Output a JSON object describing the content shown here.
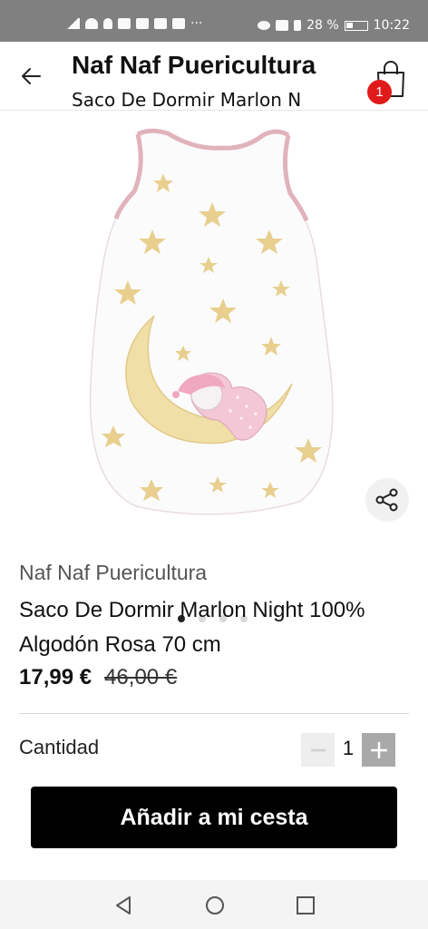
{
  "status_bar": {
    "battery": "28 %",
    "time": "10:22",
    "left_icons": [
      "signal-icon",
      "wifi-icon",
      "notification-icon",
      "whatsapp-icon",
      "gallery-icon",
      "gallery-icon",
      "mail-icon",
      "more-icon"
    ],
    "right_icons": [
      "eye-icon",
      "nfc-icon",
      "bluetooth-icon",
      "battery-icon"
    ]
  },
  "header": {
    "title": "Naf Naf Puericultura",
    "subtitle": "Saco De Dormir Marlon N",
    "cart_count": "1"
  },
  "gallery": {
    "image_icon": "sleeping-bag-product-image",
    "slides": 4,
    "active_slide": 1
  },
  "product": {
    "brand": "Naf Naf Puericultura",
    "name": "Saco De Dormir Marlon Night 100% Algodón Rosa 70 cm",
    "price": "17,99 €",
    "old_price": "46,00 €"
  },
  "quantity": {
    "label": "Cantidad",
    "value": "1"
  },
  "actions": {
    "add_to_cart": "Añadir a mi cesta"
  },
  "colors": {
    "badge": "#e01a1a",
    "button": "#000000",
    "status_bar": "#808080"
  }
}
